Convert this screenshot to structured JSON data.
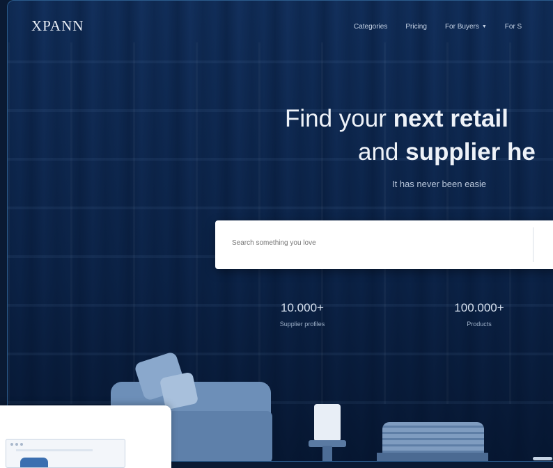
{
  "brand": {
    "logo": "XPANN"
  },
  "nav": {
    "items": [
      {
        "label": "Categories",
        "has_dropdown": false
      },
      {
        "label": "Pricing",
        "has_dropdown": false
      },
      {
        "label": "For Buyers",
        "has_dropdown": true
      },
      {
        "label": "For S",
        "has_dropdown": false
      }
    ]
  },
  "hero": {
    "line1_light": "Find your ",
    "line1_bold": "next retail",
    "line2_light": "and ",
    "line2_bold": "supplier he",
    "subtitle": "It has never been easie"
  },
  "search": {
    "placeholder": "Search something you love"
  },
  "stats": [
    {
      "value": "10.000+",
      "label": "Supplier profiles"
    },
    {
      "value": "100.000+",
      "label": "Products"
    }
  ],
  "colors": {
    "hero_bg": "#0a1a33",
    "accent": "#3b6fb0",
    "text_light": "#eef2f8"
  }
}
